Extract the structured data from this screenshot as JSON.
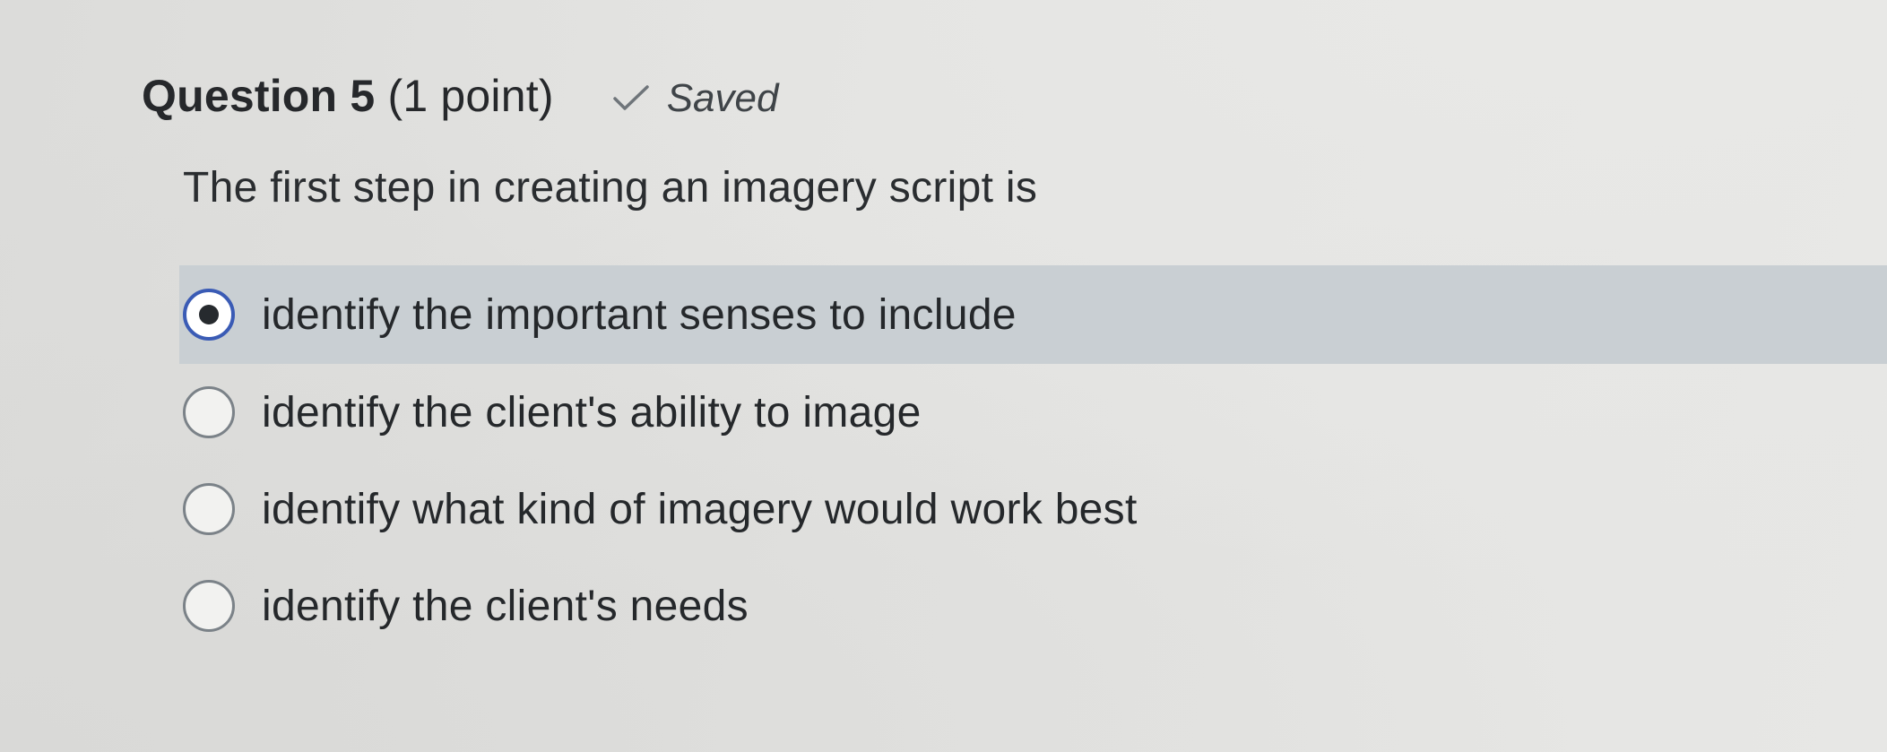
{
  "question": {
    "title": "Question 5",
    "points": "(1 point)",
    "status": {
      "icon": "checkmark-icon",
      "label": "Saved"
    },
    "text": "The first step in creating an imagery script is"
  },
  "answers": [
    {
      "label": "identify the important senses to include",
      "selected": true
    },
    {
      "label": "identify the client's ability to image",
      "selected": false
    },
    {
      "label": "identify what kind of imagery would work best",
      "selected": false
    },
    {
      "label": "identify the client's needs",
      "selected": false
    }
  ],
  "colors": {
    "selected_row": "#c9cfd3",
    "radio_focus": "#3a5bb5",
    "text": "#25282b"
  }
}
